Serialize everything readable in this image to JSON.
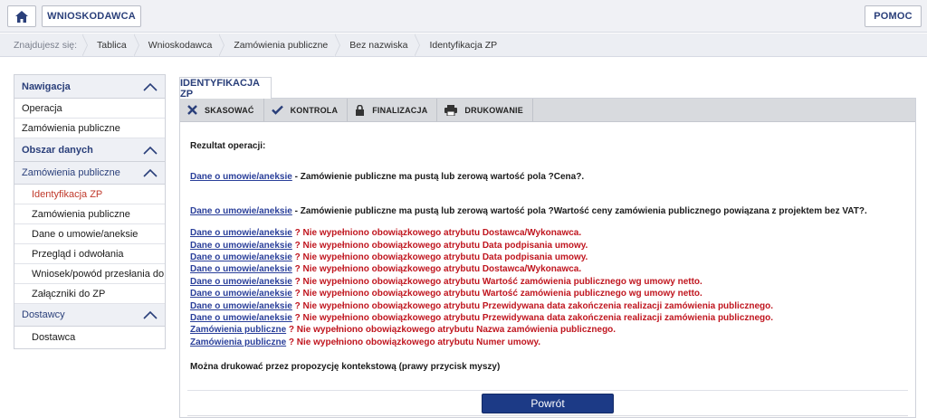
{
  "topbar": {
    "home_icon": "home-icon",
    "applicant_label": "WNIOSKODAWCA",
    "help_label": "POMOC"
  },
  "breadcrumb": {
    "lead": "Znajdujesz się:",
    "items": [
      "Tablica",
      "Wnioskodawca",
      "Zamówienia publiczne",
      "Bez nazwiska",
      "Identyfikacja ZP"
    ]
  },
  "sidebar": {
    "nav_header": "Nawigacja",
    "nav_items": [
      "Operacja",
      "Zamówienia publiczne"
    ],
    "data_header": "Obszar danych",
    "group1_header": "Zamówienia publiczne",
    "group1_items": [
      "Identyfikacja ZP",
      "Zamówienia publiczne",
      "Dane o umowie/aneksie",
      "Przegląd i odwołania",
      "Wniosek/powód przesłania do UOKiK",
      "Załączniki do ZP"
    ],
    "group2_header": "Dostawcy",
    "group2_items": [
      "Dostawca"
    ]
  },
  "tab": {
    "label": "IDENTYFIKACJA ZP"
  },
  "toolbar": {
    "cancel": "SKASOWAĆ",
    "check": "KONTROLA",
    "finalize": "FINALIZACJA",
    "print": "DRUKOWANIE"
  },
  "content": {
    "result_title": "Rezultat operacji:",
    "black_messages": [
      {
        "link": "Dane o umowie/aneksie",
        "text": " - Zamówienie publiczne ma pustą lub zerową wartość pola ?Cena?."
      },
      {
        "link": "Dane o umowie/aneksie",
        "text": " - Zamówienie publiczne ma pustą lub zerową wartość pola ?Wartość ceny zamówienia publicznego powiązana z projektem bez VAT?."
      }
    ],
    "red_messages": [
      {
        "link": "Dane o umowie/aneksie",
        "text": " ? Nie wypełniono obowiązkowego atrybutu Dostawca/Wykonawca."
      },
      {
        "link": "Dane o umowie/aneksie",
        "text": " ? Nie wypełniono obowiązkowego atrybutu Data podpisania umowy."
      },
      {
        "link": "Dane o umowie/aneksie",
        "text": " ? Nie wypełniono obowiązkowego atrybutu Data podpisania umowy."
      },
      {
        "link": "Dane o umowie/aneksie",
        "text": " ? Nie wypełniono obowiązkowego atrybutu Dostawca/Wykonawca."
      },
      {
        "link": "Dane o umowie/aneksie",
        "text": " ? Nie wypełniono obowiązkowego atrybutu Wartość zamówienia publicznego wg umowy netto."
      },
      {
        "link": "Dane o umowie/aneksie",
        "text": " ? Nie wypełniono obowiązkowego atrybutu Wartość zamówienia publicznego wg umowy netto."
      },
      {
        "link": "Dane o umowie/aneksie",
        "text": " ? Nie wypełniono obowiązkowego atrybutu Przewidywana data zakończenia realizacji zamówienia publicznego."
      },
      {
        "link": "Dane o umowie/aneksie",
        "text": " ? Nie wypełniono obowiązkowego atrybutu Przewidywana data zakończenia realizacji zamówienia publicznego."
      },
      {
        "link": "Zamówienia publiczne",
        "text": " ? Nie wypełniono obowiązkowego atrybutu Nazwa zamówienia publicznego."
      },
      {
        "link": "Zamówienia publiczne",
        "text": " ? Nie wypełniono obowiązkowego atrybutu Numer umowy."
      }
    ],
    "note": "Można drukować przez propozycję kontekstową (prawy przycisk myszy)",
    "back_button": "Powrót"
  },
  "colors": {
    "brand_blue": "#2a3f7a",
    "button_blue": "#1c3a86",
    "error_red": "#c0161f",
    "active_red": "#c0392b"
  }
}
